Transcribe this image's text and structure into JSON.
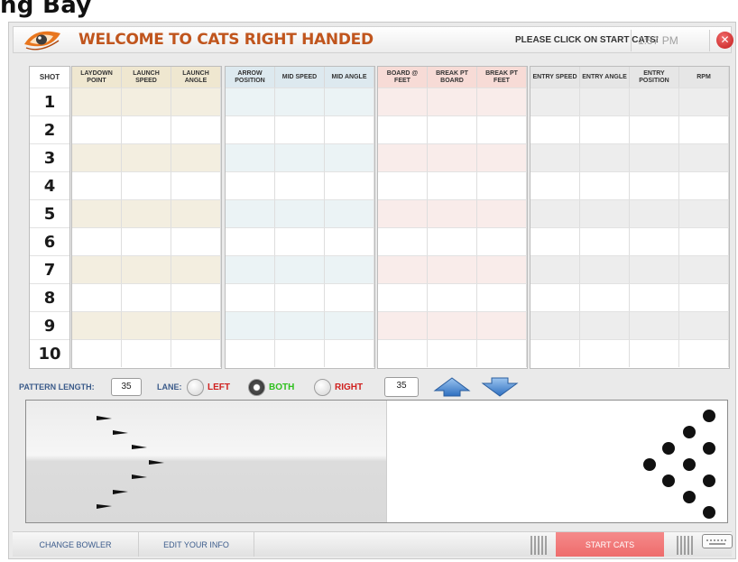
{
  "page": {
    "heading": "ng Bay"
  },
  "header": {
    "title": "WELCOME TO CATS RIGHT HANDED",
    "prompt": "PLEASE CLICK ON START CATS!",
    "time": "1:57 PM",
    "close_icon": "close-icon"
  },
  "table": {
    "shot_header": "SHOT",
    "shots": [
      "1",
      "2",
      "3",
      "4",
      "5",
      "6",
      "7",
      "8",
      "9",
      "10"
    ],
    "groups": [
      {
        "name": "launch",
        "tint": "#f3eee0",
        "headTint": "#efe7d0",
        "columns": [
          "LAYDOWN POINT",
          "LAUNCH SPEED",
          "LAUNCH ANGLE"
        ]
      },
      {
        "name": "arrow",
        "tint": "#ebf3f5",
        "headTint": "#dde9ef",
        "columns": [
          "ARROW POSITION",
          "MID SPEED",
          "MID ANGLE"
        ]
      },
      {
        "name": "board",
        "tint": "#f9ecea",
        "headTint": "#f7dbd6",
        "columns": [
          "BOARD @ FEET",
          "BREAK PT BOARD",
          "BREAK PT FEET"
        ]
      },
      {
        "name": "entry",
        "tint": "#ededed",
        "headTint": "#e6e6e6",
        "columns": [
          "ENTRY SPEED",
          "ENTRY ANGLE",
          "ENTRY POSITION",
          "RPM"
        ]
      }
    ]
  },
  "controls": {
    "pattern_length_label": "PATTERN LENGTH:",
    "pattern_length_value": "35",
    "lane_label": "LANE:",
    "lane_options": [
      {
        "label": "LEFT",
        "color": "#d0201e",
        "selected": false
      },
      {
        "label": "BOTH",
        "color": "#2fc01e",
        "selected": true
      },
      {
        "label": "RIGHT",
        "color": "#d0201e",
        "selected": false
      }
    ],
    "distance_value": "35",
    "up_icon": "arrow-up-icon",
    "down_icon": "arrow-down-icon"
  },
  "footer": {
    "change_bowler": "CHANGE BOWLER",
    "edit_info": "EDIT YOUR INFO",
    "start": "START CATS",
    "keyboard_icon": "keyboard-icon"
  }
}
